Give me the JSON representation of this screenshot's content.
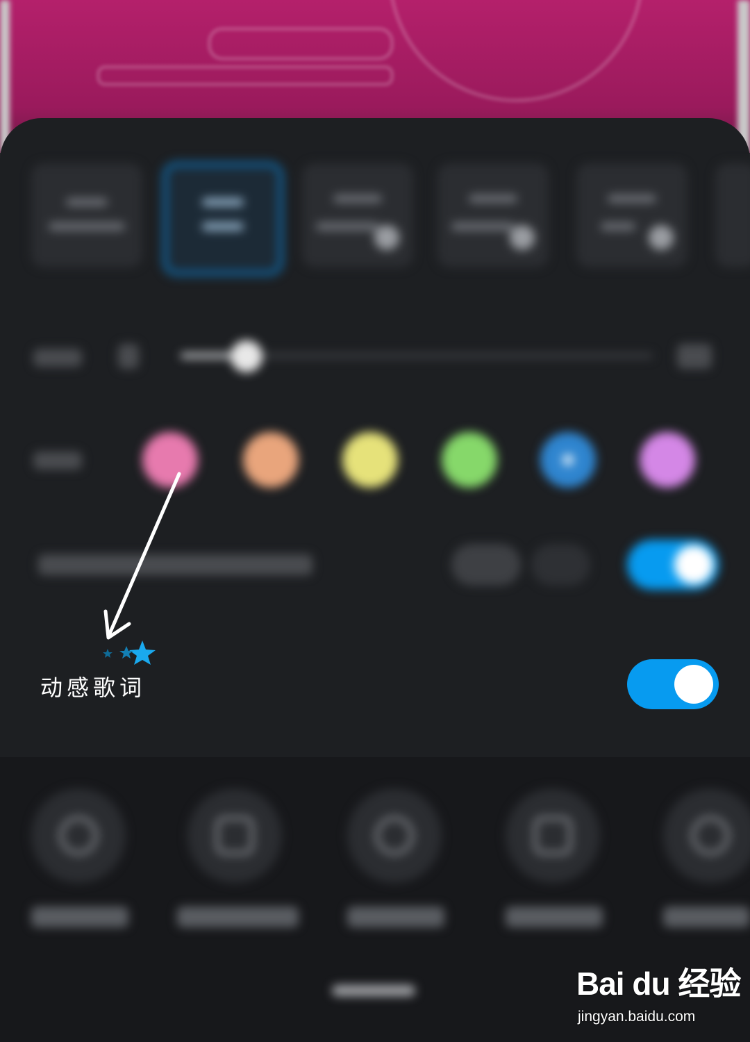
{
  "setting": {
    "dynamic_lyrics_label": "动感歌词",
    "dynamic_lyrics_enabled": true,
    "blurred_toggle_enabled": true
  },
  "color_swatches": [
    "#e77aae",
    "#e9a57c",
    "#e6e27a",
    "#86d86a",
    "#2f85cf",
    "#d487e6"
  ],
  "selected_color_index": 4,
  "slider_fraction": 0.14,
  "watermark": {
    "brand": "Bai du 经验",
    "url": "jingyan.baidu.com"
  },
  "colors": {
    "accent": "#079bf0",
    "sheet": "#1d1f22",
    "annotation_arrow": "#ffffff"
  }
}
